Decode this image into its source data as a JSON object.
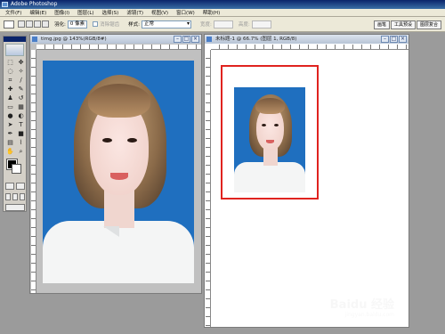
{
  "app": {
    "title": "Adobe Photoshop"
  },
  "menu": [
    "文件(F)",
    "编辑(E)",
    "图像(I)",
    "图层(L)",
    "选择(S)",
    "滤镜(T)",
    "视图(V)",
    "窗口(W)",
    "帮助(H)"
  ],
  "options": {
    "feather_label": "羽化:",
    "feather_value": "0 像素",
    "antialias_label": "消除锯齿",
    "style_label": "样式:",
    "style_value": "正常",
    "width_label": "宽度:",
    "height_label": "高度:",
    "wells": [
      "画笔",
      "工具预设",
      "图层复合"
    ]
  },
  "documents": [
    {
      "title": "timg.jpg @ 143%(RGB/8#)"
    },
    {
      "title": "未标题-1 @ 66.7% (图层 1, RGB/8)"
    }
  ],
  "watermark": {
    "logo": "Baidu 经验",
    "url": "jingyan.baidu.com"
  },
  "colors": {
    "photo_bg": "#1f6fbf",
    "highlight": "#e0231f"
  }
}
